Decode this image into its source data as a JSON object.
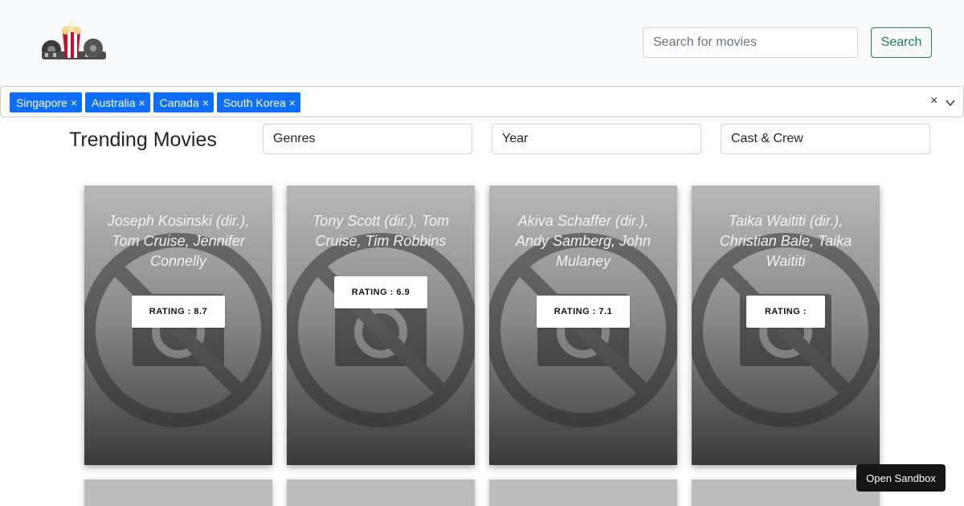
{
  "navbar": {
    "logo_icon": "popcorn-film-logo",
    "search_placeholder": "Search for movies",
    "search_button": "Search"
  },
  "region_select": {
    "chips": [
      "Singapore",
      "Australia",
      "Canada",
      "South Korea"
    ],
    "chip_remove_symbol": "×",
    "clear_symbol": "×"
  },
  "main": {
    "heading": "Trending Movies",
    "filters": [
      "Genres",
      "Year",
      "Cast & Crew"
    ]
  },
  "movies": [
    {
      "cast": "Joseph Kosinski (dir.), Tom Cruise, Jennifer Connelly",
      "rating": "RATING : 8.7"
    },
    {
      "cast": "Tony Scott (dir.), Tom Cruise, Tim Robbins",
      "rating": "RATING : 6.9"
    },
    {
      "cast": "Akiva Schaffer (dir.), Andy Samberg, John Mulaney",
      "rating": "RATING : 7.1"
    },
    {
      "cast": "Taika Waititi (dir.), Christian Bale, Taika Waititi",
      "rating": "RATING :"
    }
  ],
  "colors": {
    "chip": "#0d6efd",
    "search_button": "#198754"
  },
  "sandbox": {
    "label": "Open Sandbox"
  }
}
